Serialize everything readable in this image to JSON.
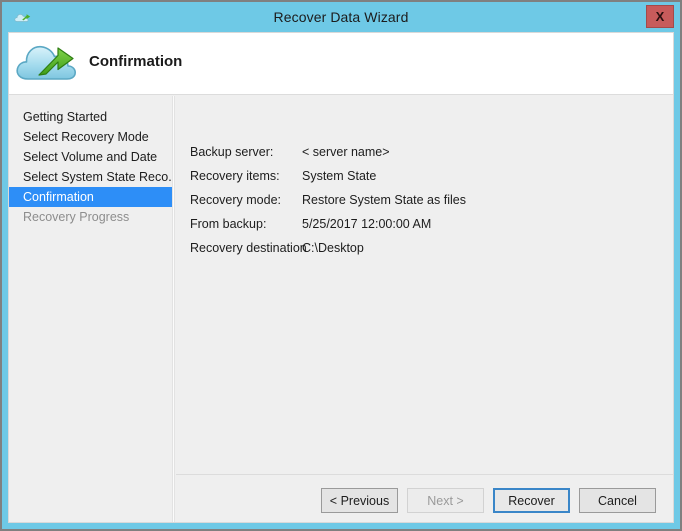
{
  "window": {
    "title": "Recover Data Wizard",
    "title_icon": "cloud-icon",
    "close_label": "X",
    "titlebar_color": "#6ec9e6",
    "close_color": "#c75b5b"
  },
  "header": {
    "icon": "cloud-recovery-icon",
    "title": "Confirmation"
  },
  "sidebar": {
    "items": [
      {
        "label": "Getting Started",
        "state": "normal"
      },
      {
        "label": "Select Recovery Mode",
        "state": "normal"
      },
      {
        "label": "Select Volume and Date",
        "state": "normal"
      },
      {
        "label": "Select System State Reco...",
        "state": "normal"
      },
      {
        "label": "Confirmation",
        "state": "active"
      },
      {
        "label": "Recovery Progress",
        "state": "disabled"
      }
    ],
    "active_color": "#2d8ef7"
  },
  "content": {
    "fields": [
      {
        "label": "Backup server:",
        "value": "< server name>"
      },
      {
        "label": "Recovery items:",
        "value": "System State"
      },
      {
        "label": "Recovery mode:",
        "value": "Restore System State as files"
      },
      {
        "label": "From backup:",
        "value": "5/25/2017 12:00:00 AM"
      },
      {
        "label": "Recovery destination",
        "value": "C:\\Desktop"
      }
    ]
  },
  "footer": {
    "buttons": [
      {
        "label": "< Previous",
        "state": "normal"
      },
      {
        "label": "Next >",
        "state": "disabled"
      },
      {
        "label": "Recover",
        "state": "default"
      },
      {
        "label": "Cancel",
        "state": "normal"
      }
    ]
  }
}
